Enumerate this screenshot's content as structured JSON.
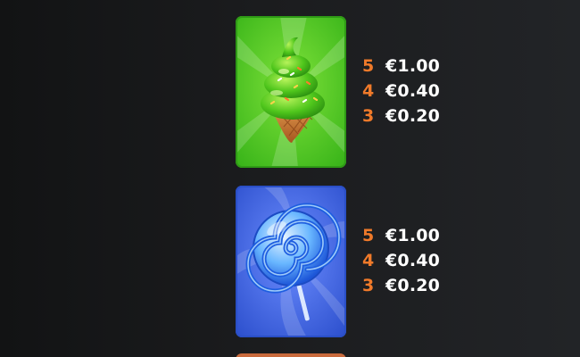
{
  "paytable": [
    {
      "symbol_icon": "green-ice-cream-cone-icon",
      "card_color": "#3cc21c",
      "rows": [
        {
          "count": "5",
          "amount": "€1.00"
        },
        {
          "count": "4",
          "amount": "€0.40"
        },
        {
          "count": "3",
          "amount": "€0.20"
        }
      ]
    },
    {
      "symbol_icon": "blue-lollipop-icon",
      "card_color": "#3a68e6",
      "rows": [
        {
          "count": "5",
          "amount": "€1.00"
        },
        {
          "count": "4",
          "amount": "€0.40"
        },
        {
          "count": "3",
          "amount": "€0.20"
        }
      ]
    }
  ],
  "colors": {
    "count_text": "#f07a2a",
    "amount_text": "#ffffff",
    "background": "#1b1c1e"
  }
}
